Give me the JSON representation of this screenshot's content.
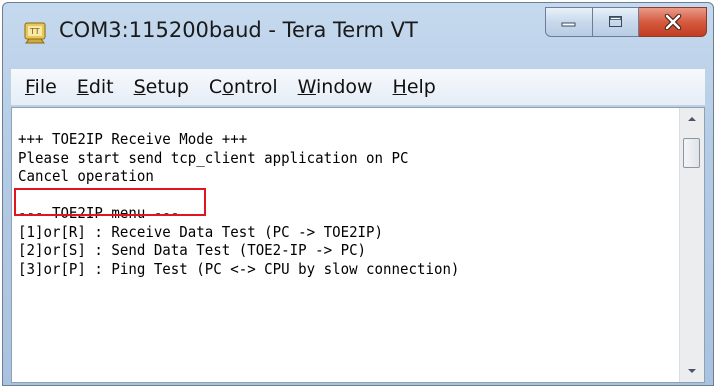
{
  "window": {
    "title": "COM3:115200baud - Tera Term VT",
    "icon": "tera-term-app-icon",
    "caption_buttons": [
      "minimize",
      "maximize",
      "close"
    ]
  },
  "menu": {
    "items": [
      {
        "label_pre": "",
        "mnemonic": "F",
        "label_post": "ile"
      },
      {
        "label_pre": "",
        "mnemonic": "E",
        "label_post": "dit"
      },
      {
        "label_pre": "",
        "mnemonic": "S",
        "label_post": "etup"
      },
      {
        "label_pre": "C",
        "mnemonic": "o",
        "label_post": "ntrol"
      },
      {
        "label_pre": "",
        "mnemonic": "W",
        "label_post": "indow"
      },
      {
        "label_pre": "",
        "mnemonic": "H",
        "label_post": "elp"
      }
    ]
  },
  "terminal": {
    "lines": [
      "+++ TOE2IP Receive Mode +++",
      "Please start send tcp_client application on PC",
      "Cancel operation",
      "",
      "--- TOE2IP menu ---",
      "[1]or[R] : Receive Data Test (PC -> TOE2IP)",
      "[2]or[S] : Send Data Test (TOE2-IP -> PC)",
      "[3]or[P] : Ping Test (PC <-> CPU by slow connection)"
    ],
    "highlight_color": "#e0161e"
  },
  "colors": {
    "titlebar": "#b4cbe4",
    "close_button": "#d55a3f",
    "terminal_bg": "#ffffff"
  }
}
